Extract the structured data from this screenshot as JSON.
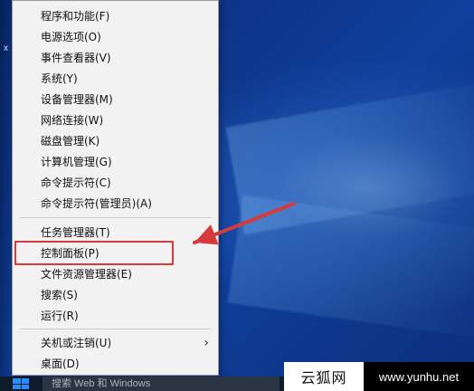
{
  "desktop": {
    "left_fragment": "x"
  },
  "context_menu": {
    "groups": [
      {
        "items": [
          {
            "label": "程序和功能(F)"
          },
          {
            "label": "电源选项(O)"
          },
          {
            "label": "事件查看器(V)"
          },
          {
            "label": "系统(Y)"
          },
          {
            "label": "设备管理器(M)"
          },
          {
            "label": "网络连接(W)"
          },
          {
            "label": "磁盘管理(K)"
          },
          {
            "label": "计算机管理(G)"
          },
          {
            "label": "命令提示符(C)"
          },
          {
            "label": "命令提示符(管理员)(A)"
          }
        ]
      },
      {
        "items": [
          {
            "label": "任务管理器(T)"
          },
          {
            "label": "控制面板(P)"
          },
          {
            "label": "文件资源管理器(E)"
          },
          {
            "label": "搜索(S)"
          },
          {
            "label": "运行(R)"
          }
        ]
      },
      {
        "items": [
          {
            "label": "关机或注销(U)",
            "submenu": true,
            "submenu_icon": "chevron-right-icon"
          },
          {
            "label": "桌面(D)"
          }
        ]
      }
    ],
    "highlighted_item": "控制面板(P)"
  },
  "annotations": {
    "arrow_color": "#d73a3a",
    "box_color": "#d73a3a"
  },
  "taskbar": {
    "search_placeholder": "搜索 Web 和 Windows",
    "start_icon": "windows-start-icon"
  },
  "watermark": {
    "left_text": "云狐网",
    "right_text": "www.yunhu.net"
  }
}
